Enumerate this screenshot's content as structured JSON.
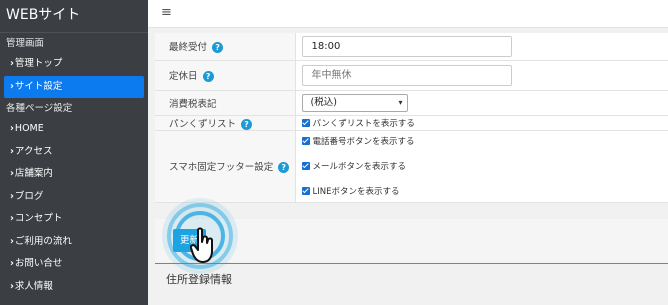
{
  "app": {
    "title": "WEBサイト"
  },
  "sidebar": {
    "sections": [
      {
        "label": "管理画面",
        "items": [
          {
            "label": "管理トップ",
            "active": false
          },
          {
            "label": "サイト設定",
            "active": true
          }
        ]
      },
      {
        "label": "各種ページ設定",
        "items": [
          {
            "label": "HOME"
          },
          {
            "label": "アクセス"
          },
          {
            "label": "店舗案内"
          },
          {
            "label": "ブログ"
          },
          {
            "label": "コンセプト"
          },
          {
            "label": "ご利用の流れ"
          },
          {
            "label": "お問い合せ"
          },
          {
            "label": "求人情報"
          }
        ]
      }
    ],
    "chevron": "›"
  },
  "topbar": {
    "menu_icon": "hamburger-icon",
    "menu_glyph": "≡"
  },
  "form": {
    "help_glyph": "?",
    "last_order": {
      "label": "最終受付",
      "value": "18:00"
    },
    "holiday": {
      "label": "定休日",
      "placeholder": "年中無休"
    },
    "tax": {
      "label": "消費税表記",
      "selected": "(税込)",
      "caret": "▾"
    },
    "breadcrumb": {
      "label": "パンくずリスト",
      "checkbox": "パンくずリストを表示する"
    },
    "footer": {
      "label": "スマホ固定フッター設定",
      "options": [
        "電話番号ボタンを表示する",
        "メールボタンを表示する",
        "LINEボタンを表示する"
      ]
    }
  },
  "actions": {
    "update_label": "更新"
  },
  "next_section": {
    "title": "住所登録情報"
  },
  "colors": {
    "sidebar_bg": "#3b3f44",
    "active": "#0d7bf0",
    "accent": "#1da3e0",
    "checkbox": "#1570d6"
  }
}
